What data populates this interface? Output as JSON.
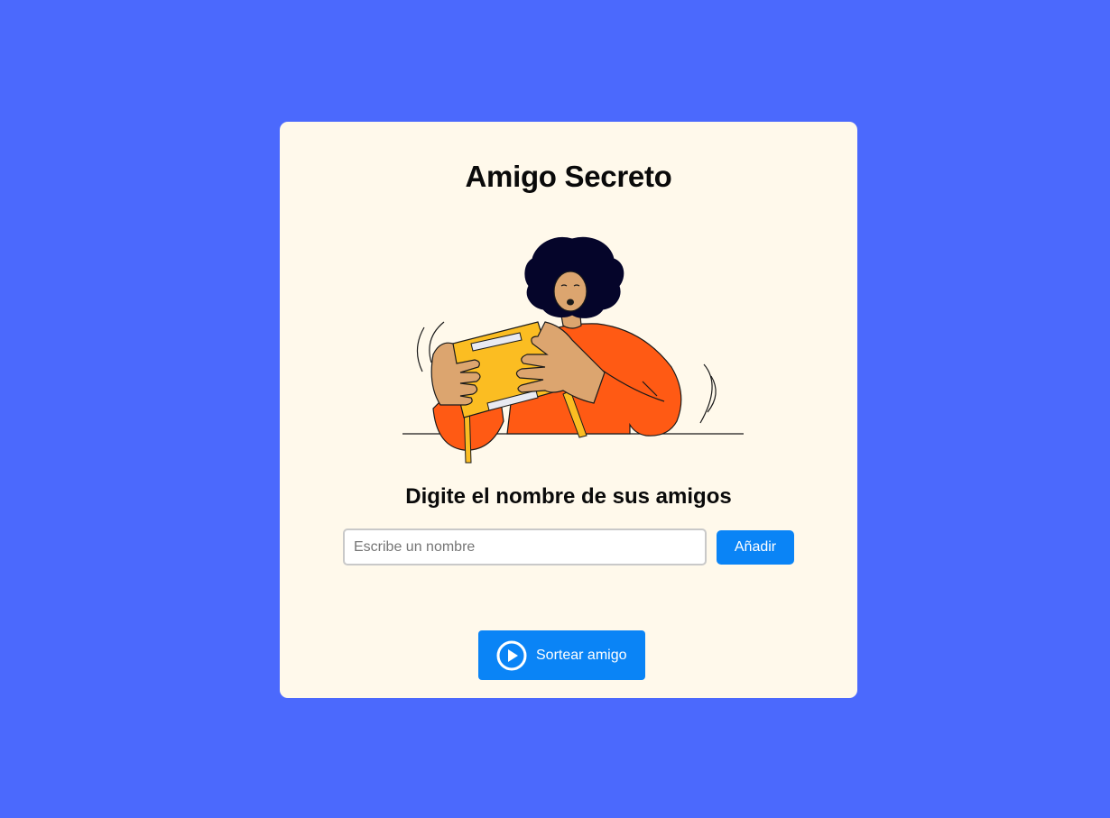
{
  "card": {
    "title": "Amigo Secreto",
    "subtitle": "Digite el nombre de sus amigos"
  },
  "illustration": {
    "description_icon": "person-playing-handheld-console-illustration"
  },
  "form": {
    "name_input_placeholder": "Escribe un nombre",
    "name_input_value": "",
    "add_button_label": "Añadir"
  },
  "actions": {
    "draw_button_label": "Sortear amigo",
    "draw_button_icon": "play-circle-icon"
  },
  "colors": {
    "background": "#4b69fd",
    "card": "#fff9eb",
    "button": "#0a84f6"
  }
}
